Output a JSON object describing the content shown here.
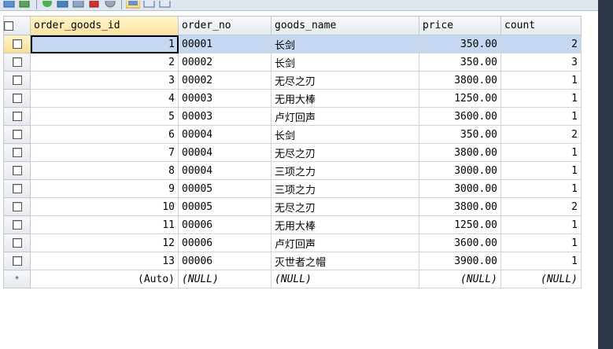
{
  "grid": {
    "columns": [
      "order_goods_id",
      "order_no",
      "goods_name",
      "price",
      "count"
    ],
    "rows": [
      {
        "id": "1",
        "order_no": "00001",
        "goods_name": "长剑",
        "price": "350.00",
        "count": "2"
      },
      {
        "id": "2",
        "order_no": "00002",
        "goods_name": "长剑",
        "price": "350.00",
        "count": "3"
      },
      {
        "id": "3",
        "order_no": "00002",
        "goods_name": "无尽之刃",
        "price": "3800.00",
        "count": "1"
      },
      {
        "id": "4",
        "order_no": "00003",
        "goods_name": "无用大棒",
        "price": "1250.00",
        "count": "1"
      },
      {
        "id": "5",
        "order_no": "00003",
        "goods_name": "卢灯回声",
        "price": "3600.00",
        "count": "1"
      },
      {
        "id": "6",
        "order_no": "00004",
        "goods_name": "长剑",
        "price": "350.00",
        "count": "2"
      },
      {
        "id": "7",
        "order_no": "00004",
        "goods_name": "无尽之刃",
        "price": "3800.00",
        "count": "1"
      },
      {
        "id": "8",
        "order_no": "00004",
        "goods_name": "三项之力",
        "price": "3000.00",
        "count": "1"
      },
      {
        "id": "9",
        "order_no": "00005",
        "goods_name": "三项之力",
        "price": "3000.00",
        "count": "1"
      },
      {
        "id": "10",
        "order_no": "00005",
        "goods_name": "无尽之刃",
        "price": "3800.00",
        "count": "2"
      },
      {
        "id": "11",
        "order_no": "00006",
        "goods_name": "无用大棒",
        "price": "1250.00",
        "count": "1"
      },
      {
        "id": "12",
        "order_no": "00006",
        "goods_name": "卢灯回声",
        "price": "3600.00",
        "count": "1"
      },
      {
        "id": "13",
        "order_no": "00006",
        "goods_name": "灭世者之帽",
        "price": "3900.00",
        "count": "1"
      }
    ],
    "new_row": {
      "marker": "*",
      "id": "(Auto)",
      "order_no": "(NULL)",
      "goods_name": "(NULL)",
      "price": "(NULL)",
      "count": "(NULL)"
    }
  },
  "toolbar": {
    "icons": [
      "grid-view-icon",
      "export-icon",
      "add-row-icon",
      "save-icon",
      "image-icon",
      "delete-row-icon",
      "refresh-icon",
      "table-view-icon",
      "form-view-icon",
      "text-view-icon"
    ]
  },
  "colors": {
    "selection": "#c6d7f2",
    "header": "#e5e9ef",
    "active_header": "#fde3a0",
    "side_strip": "#2e3846"
  }
}
